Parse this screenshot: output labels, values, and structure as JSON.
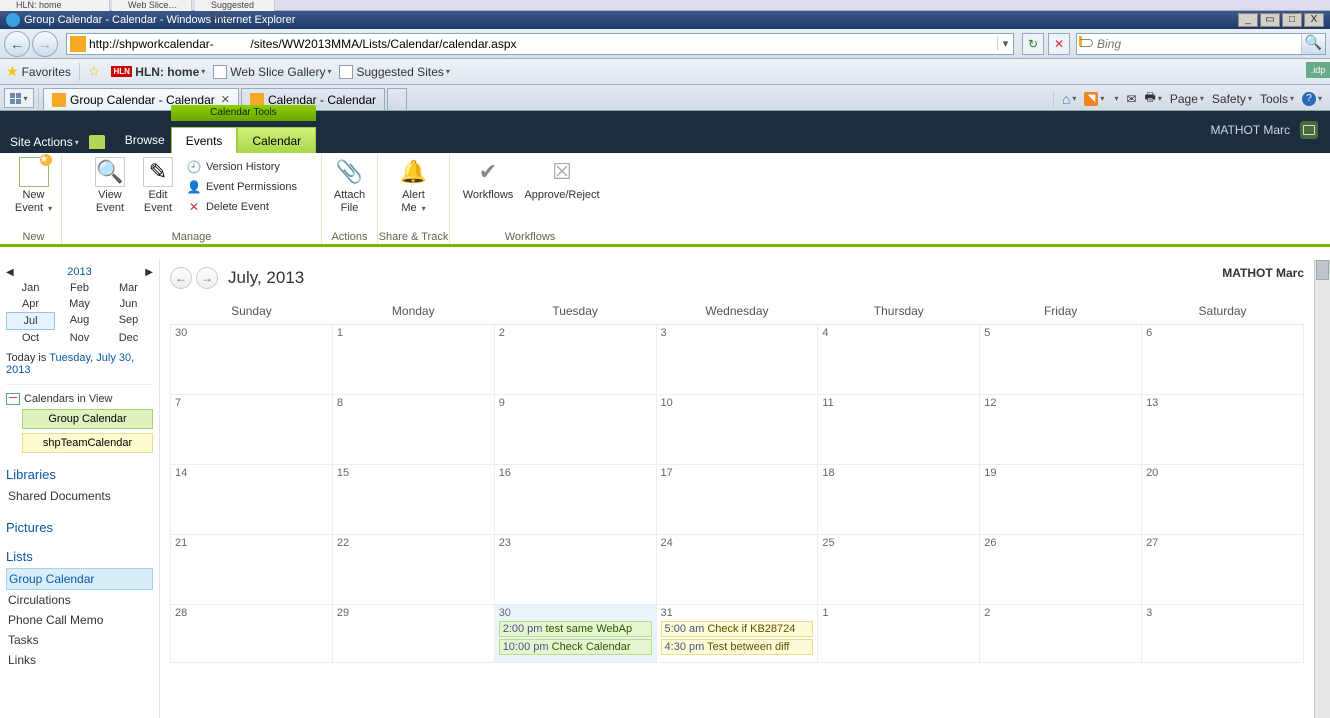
{
  "window": {
    "title": "Group Calendar - Calendar - Windows Internet Explorer",
    "min": "_",
    "restore": "▭",
    "max": "□",
    "close": "X"
  },
  "top_tabs": {
    "t1": "HLN: home",
    "t2": "Web Slice…",
    "t3": "Suggested Sites"
  },
  "address": {
    "url": "http://shpworkcalendar-           /sites/WW2013MMA/Lists/Calendar/calendar.aspx"
  },
  "search": {
    "placeholder": "Bing"
  },
  "favorites": {
    "label": "Favorites",
    "hln": "HLN: home",
    "webslice": "Web Slice Gallery",
    "suggested": "Suggested Sites"
  },
  "tabs": {
    "t1": "Group Calendar - Calendar",
    "t2": "Calendar - Calendar"
  },
  "cmd": {
    "page": "Page",
    "safety": "Safety",
    "tools": "Tools"
  },
  "sp": {
    "site_actions": "Site Actions",
    "browse": "Browse",
    "cal_tools": "Calendar Tools",
    "events": "Events",
    "calendar": "Calendar",
    "user": "MATHOT Marc",
    "user_ext": "        "
  },
  "ribbon": {
    "new_event": "New\nEvent",
    "view_event": "View\nEvent",
    "edit_event": "Edit\nEvent",
    "version": "Version History",
    "perm": "Event Permissions",
    "delete": "Delete Event",
    "attach": "Attach\nFile",
    "alert": "Alert\nMe",
    "workflows": "Workflows",
    "approve": "Approve/Reject",
    "g_new": "New",
    "g_manage": "Manage",
    "g_actions": "Actions",
    "g_share": "Share & Track",
    "g_wf": "Workflows"
  },
  "minical": {
    "year": "2013",
    "months": [
      "Jan",
      "Feb",
      "Mar",
      "Apr",
      "May",
      "Jun",
      "Jul",
      "Aug",
      "Sep",
      "Oct",
      "Nov",
      "Dec"
    ],
    "today_prefix": "Today is ",
    "today": "Tuesday, July 30, 2013"
  },
  "civ": {
    "head": "Calendars in View",
    "c1": "Group Calendar",
    "c2": "shpTeamCalendar"
  },
  "nav": {
    "libraries": "Libraries",
    "shared_docs": "Shared Documents",
    "pictures": "Pictures",
    "lists": "Lists",
    "group_cal": "Group Calendar",
    "circ": "Circulations",
    "phone": "Phone Call Memo",
    "tasks": "Tasks",
    "links": "Links"
  },
  "cal": {
    "title": "July, 2013",
    "user": "MATHOT Marc",
    "days": [
      "Sunday",
      "Monday",
      "Tuesday",
      "Wednesday",
      "Thursday",
      "Friday",
      "Saturday"
    ],
    "rows": [
      [
        "30",
        "1",
        "2",
        "3",
        "4",
        "5",
        "6"
      ],
      [
        "7",
        "8",
        "9",
        "10",
        "11",
        "12",
        "13"
      ],
      [
        "14",
        "15",
        "16",
        "17",
        "18",
        "19",
        "20"
      ],
      [
        "21",
        "22",
        "23",
        "24",
        "25",
        "26",
        "27"
      ],
      [
        "28",
        "29",
        "30",
        "31",
        "1",
        "2",
        "3"
      ]
    ],
    "e30a_t": "2:00 pm",
    "e30a": "test same WebAp",
    "e30b_t": "10:00 pm",
    "e30b": "Check Calendar",
    "e31a_t": "5:00 am",
    "e31a": "Check if KB28724",
    "e31b_t": "4:30 pm",
    "e31b": "Test between diff"
  },
  "idp": ".idp"
}
